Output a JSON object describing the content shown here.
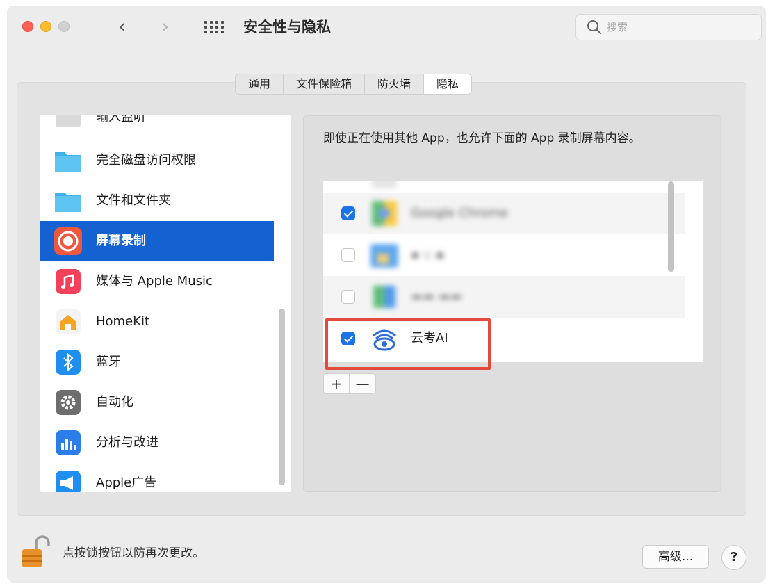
{
  "window": {
    "title": "安全性与隐私",
    "search_placeholder": "搜索"
  },
  "tabs": [
    {
      "label": "通用",
      "active": false
    },
    {
      "label": "文件保险箱",
      "active": false
    },
    {
      "label": "防火墙",
      "active": false
    },
    {
      "label": "隐私",
      "active": true
    }
  ],
  "sidebar": {
    "items": [
      {
        "label": "输入监听",
        "icon": "input-monitoring-icon"
      },
      {
        "label": "完全磁盘访问权限",
        "icon": "folder-icon"
      },
      {
        "label": "文件和文件夹",
        "icon": "folder-icon"
      },
      {
        "label": "屏幕录制",
        "icon": "screen-recording-icon",
        "selected": true
      },
      {
        "label": "媒体与 Apple Music",
        "icon": "music-icon"
      },
      {
        "label": "HomeKit",
        "icon": "home-icon"
      },
      {
        "label": "蓝牙",
        "icon": "bluetooth-icon"
      },
      {
        "label": "自动化",
        "icon": "gear-icon"
      },
      {
        "label": "分析与改进",
        "icon": "analytics-icon"
      },
      {
        "label": "Apple广告",
        "icon": "megaphone-icon"
      }
    ]
  },
  "content": {
    "description": "即使正在使用其他 App，也允许下面的 App 录制屏幕内容。",
    "apps": [
      {
        "name": "",
        "checked": false
      },
      {
        "name": "Google Chrome",
        "checked": true
      },
      {
        "name": "",
        "checked": false
      },
      {
        "name": "",
        "checked": false
      },
      {
        "name": "云考AI",
        "checked": true
      }
    ],
    "add_label": "+",
    "remove_label": "—"
  },
  "footer": {
    "lock_text": "点按锁按钮以防再次更改。",
    "advanced_label": "高级...",
    "help_label": "?"
  },
  "colors": {
    "selection": "#1462d2",
    "checkbox": "#1a73e8",
    "highlight": "#e24a3b"
  }
}
